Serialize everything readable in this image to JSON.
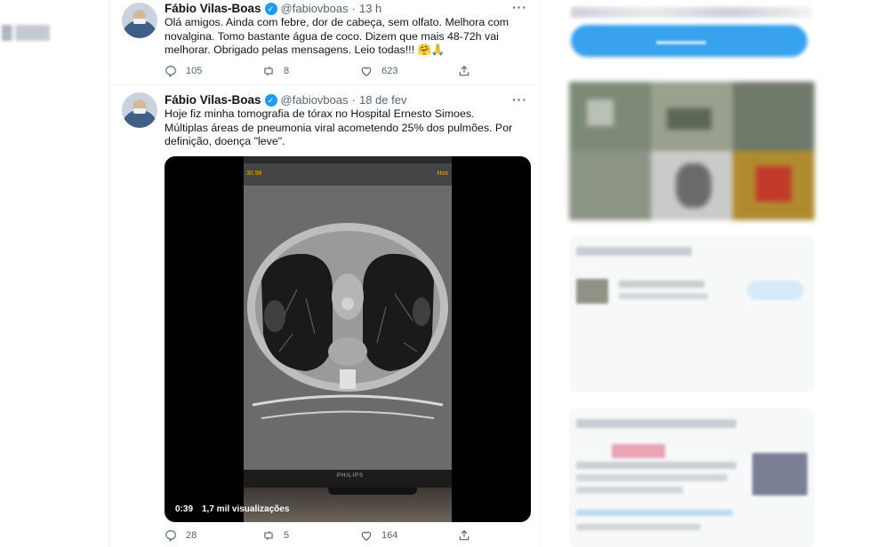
{
  "tweets": [
    {
      "name": "Fábio Vilas-Boas",
      "handle": "@fabiovboas",
      "separator": "·",
      "time": "13 h",
      "text": "Olá amigos. Ainda com febre, dor de cabeça, sem olfato. Melhora com novalgina. Tomo bastante água de coco. Dizem que mais 48-72h vai melhorar. Obrigado pelas mensagens. Leio todas!!! 🤗🙏",
      "replies": "105",
      "retweets": "8",
      "likes": "623"
    },
    {
      "name": "Fábio Vilas-Boas",
      "handle": "@fabiovboas",
      "separator": "·",
      "time": "18 de fev",
      "text": "Hoje fiz minha tomografia de tórax no Hospital Ernesto Simoes. Múltiplas áreas de pneumonia viral acometendo 25% dos pulmões. Por definição, doença \"leve\".",
      "video": {
        "duration": "0:39",
        "views": "1,7 mil visualizações",
        "hud_left": "30.98",
        "hud_right": "Hos",
        "monitor_brand": "PHILIPS"
      },
      "replies": "28",
      "retweets": "5",
      "likes": "164"
    }
  ],
  "icons": {
    "reply": "reply-icon",
    "retweet": "retweet-icon",
    "like": "heart-icon",
    "share": "share-icon",
    "verified": "verified-badge-icon",
    "more": "more-options-icon"
  },
  "colors": {
    "accent": "#1d9bf0",
    "text": "#0f1419",
    "muted": "#536471"
  }
}
